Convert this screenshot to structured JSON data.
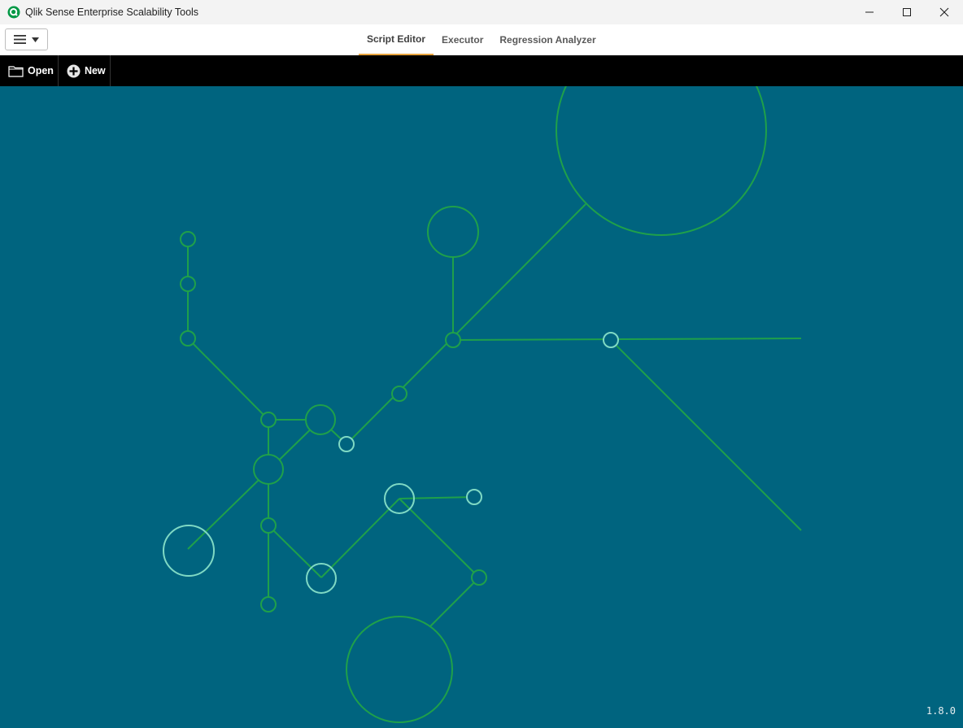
{
  "window": {
    "title": "Qlik Sense Enterprise Scalability Tools",
    "app_icon": "qlik-q-icon",
    "controls": [
      "minimize-icon",
      "maximize-icon",
      "close-icon"
    ]
  },
  "nav": {
    "menu_icon": "hamburger-menu-icon",
    "tabs": [
      {
        "label": "Script Editor",
        "active": true
      },
      {
        "label": "Executor",
        "active": false
      },
      {
        "label": "Regression Analyzer",
        "active": false
      }
    ]
  },
  "toolbar": {
    "open_label": "Open",
    "open_icon": "folder-icon",
    "new_label": "New",
    "new_icon": "plus-circle-icon"
  },
  "footer": {
    "version": "1.8.0"
  },
  "colors": {
    "background": "#00647f",
    "line": "#1fa04a",
    "node_light": "#7fd9c4",
    "tab_accent": "#e8a33d"
  }
}
